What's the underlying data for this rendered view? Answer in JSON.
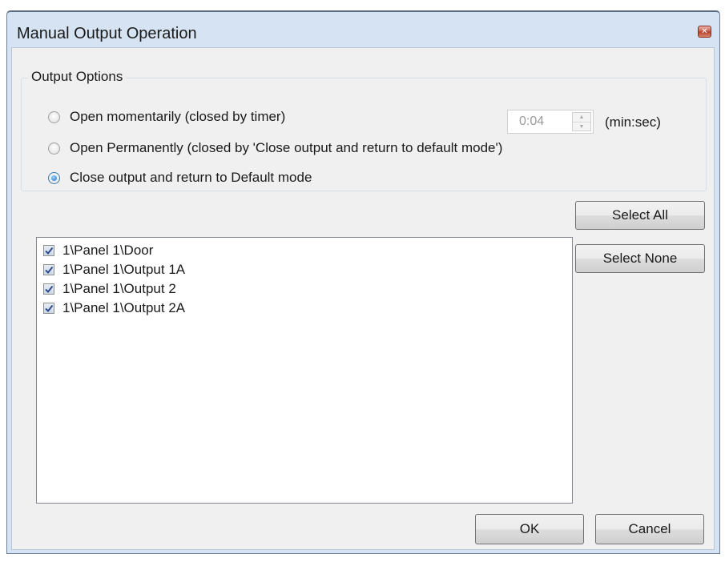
{
  "window": {
    "title": "Manual Output Operation",
    "close_icon": "close-icon"
  },
  "output_options": {
    "label": "Output Options",
    "options": [
      {
        "label": "Open momentarily (closed by timer)",
        "selected": false
      },
      {
        "label": "Open Permanently (closed by 'Close output and return to default mode')",
        "selected": false
      },
      {
        "label": "Close output and return to Default mode",
        "selected": true
      }
    ],
    "timer": {
      "value": "0:04",
      "unit": "(min:sec)",
      "enabled": false
    }
  },
  "outputs": {
    "items": [
      {
        "label": "1\\Panel 1\\Door",
        "checked": true
      },
      {
        "label": "1\\Panel 1\\Output 1A",
        "checked": true
      },
      {
        "label": "1\\Panel 1\\Output 2",
        "checked": true
      },
      {
        "label": "1\\Panel 1\\Output 2A",
        "checked": true
      }
    ]
  },
  "buttons": {
    "select_all": "Select All",
    "select_none": "Select None",
    "ok": "OK",
    "cancel": "Cancel"
  },
  "colors": {
    "window_frame": "#d5e3f2",
    "client_bg": "#f0f0f0",
    "check_mark": "#2a4f8f",
    "radio_dot": "#1c6fc2"
  }
}
